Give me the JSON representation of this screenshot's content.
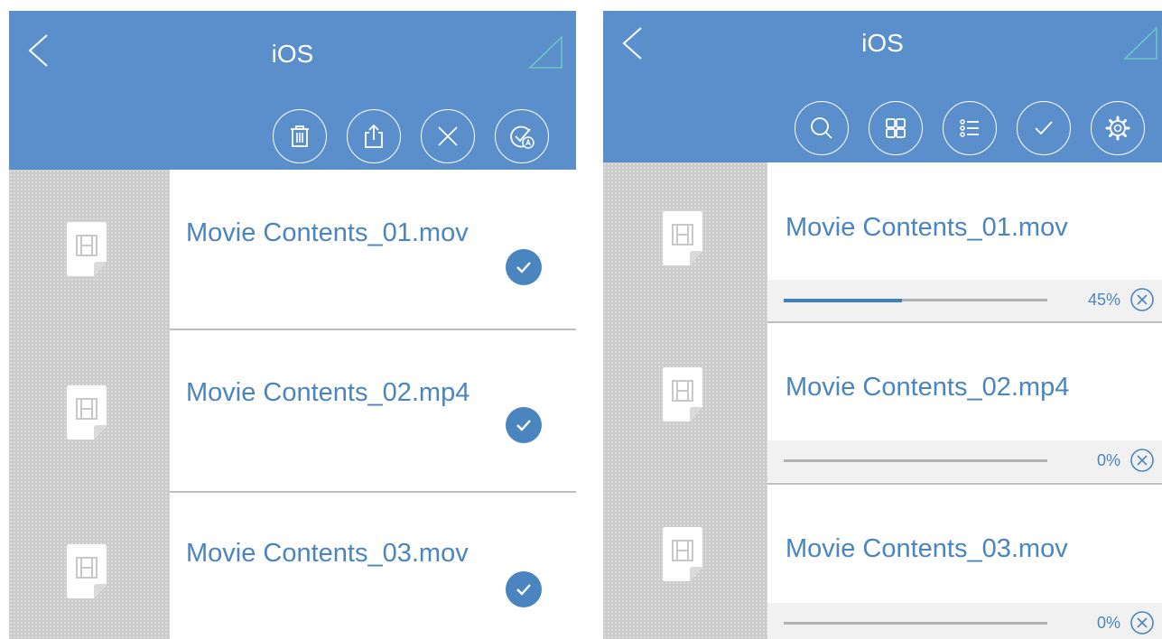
{
  "left_panel": {
    "title": "iOS",
    "icons": {
      "back": "chevron-left-icon",
      "corner": "triangle-corner-icon",
      "toolbar": [
        "trash-icon",
        "share-icon",
        "close-icon",
        "select-all-icon"
      ]
    },
    "items": [
      {
        "name": "Movie Contents_01.mov",
        "selected": true
      },
      {
        "name": "Movie Contents_02.mp4",
        "selected": true
      },
      {
        "name": "Movie Contents_03.mov",
        "selected": true
      }
    ]
  },
  "right_panel": {
    "title": "iOS",
    "icons": {
      "back": "chevron-left-icon",
      "corner": "triangle-corner-icon",
      "toolbar": [
        "search-icon",
        "grid-view-icon",
        "list-view-icon",
        "checkmark-icon",
        "settings-icon"
      ]
    },
    "items": [
      {
        "name": "Movie Contents_01.mov",
        "progress_text": "45%",
        "progress": 45
      },
      {
        "name": "Movie Contents_02.mp4",
        "progress_text": "0%",
        "progress": 0
      },
      {
        "name": "Movie Contents_03.mov",
        "progress_text": "0%",
        "progress": 0
      }
    ]
  },
  "colors": {
    "header": "#5a8fcb",
    "accent": "#4a85bf",
    "progress_fill": "#3f80c2",
    "thumb_column": "#cccccc"
  }
}
